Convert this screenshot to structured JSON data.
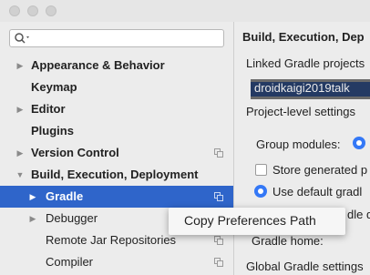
{
  "search": {
    "value": "",
    "placeholder": ""
  },
  "sidebar": {
    "items": [
      {
        "label": "Appearance & Behavior",
        "arrow": "▶",
        "bold": true
      },
      {
        "label": "Keymap",
        "arrow": "",
        "bold": true
      },
      {
        "label": "Editor",
        "arrow": "▶",
        "bold": true
      },
      {
        "label": "Plugins",
        "arrow": "",
        "bold": true
      },
      {
        "label": "Version Control",
        "arrow": "▶",
        "bold": true
      },
      {
        "label": "Build, Execution, Deployment",
        "arrow": "▼",
        "bold": true
      },
      {
        "label": "Gradle",
        "arrow": "▶",
        "bold": true,
        "selected": true
      },
      {
        "label": "Debugger",
        "arrow": "▶",
        "bold": false
      },
      {
        "label": "Remote Jar Repositories",
        "arrow": "",
        "bold": false
      },
      {
        "label": "Compiler",
        "arrow": "",
        "bold": false
      }
    ]
  },
  "settings": {
    "heading": "Build, Execution, Dep",
    "linked_projects_label": "Linked Gradle projects",
    "linked_project": "droidkaigi2019talk",
    "project_level_label": "Project-level settings",
    "group_modules_label": "Group modules:",
    "store_generated_label": "Store generated p",
    "use_default_gradle_label": "Use default gradl",
    "gradle_partial_label": "dle d",
    "gradle_home_label": "Gradle home:",
    "global_settings_label": "Global Gradle settings"
  },
  "context_menu": {
    "items": [
      "Copy Preferences Path"
    ]
  },
  "colors": {
    "selection": "#2f65ca",
    "accent": "#3478f6"
  }
}
